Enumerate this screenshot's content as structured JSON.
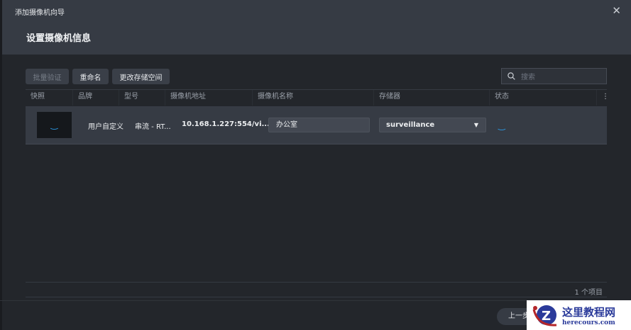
{
  "window": {
    "title": "添加摄像机向导",
    "close": "✕"
  },
  "section_title": "设置摄像机信息",
  "toolbar": {
    "batch_verify": "批量验证",
    "rename": "重命名",
    "change_storage": "更改存储空间",
    "search_placeholder": "搜索"
  },
  "table": {
    "columns": [
      "快照",
      "品牌",
      "型号",
      "摄像机地址",
      "摄像机名称",
      "存储器",
      "状态"
    ],
    "rows": [
      {
        "brand": "用户自定义",
        "model": "串流 - RT...",
        "address": "10.168.1.227:554/vi...",
        "name": "办公室",
        "storage": "surveillance"
      }
    ]
  },
  "count": "1 个项目",
  "footer": {
    "prev": "上一步"
  },
  "watermark": {
    "title": "这里教程网",
    "url": "herecours.com"
  },
  "colors": {
    "accent": "#2b9be8",
    "header": "#363b44",
    "bg": "#23262b"
  }
}
